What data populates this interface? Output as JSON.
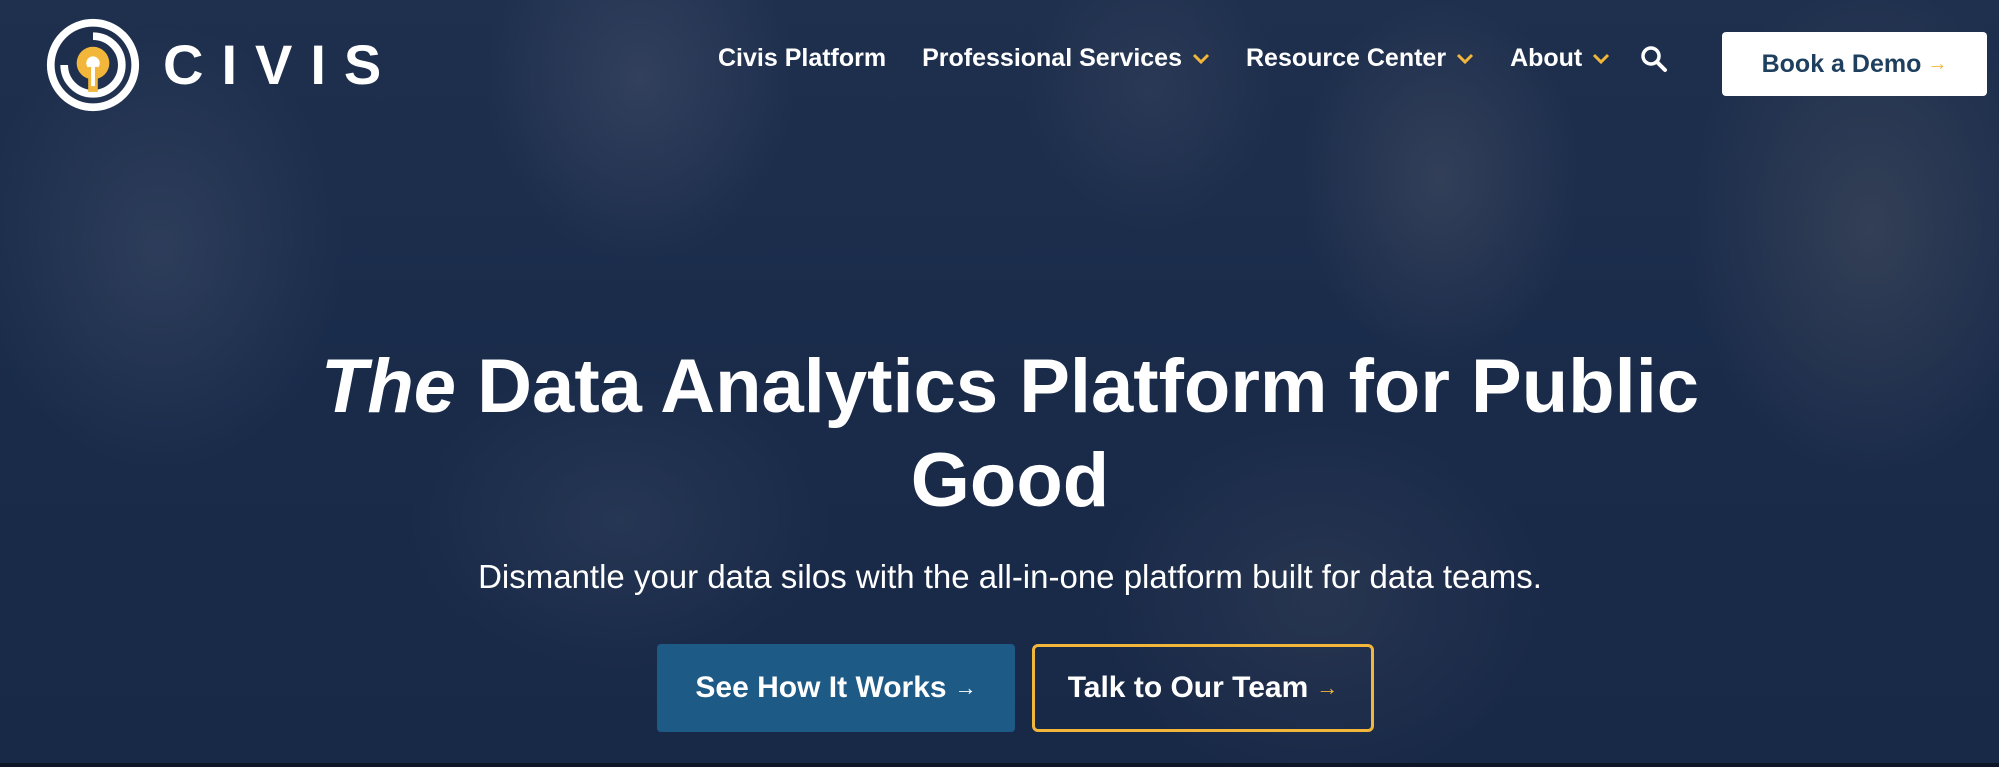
{
  "brand": {
    "name": "CIVIS",
    "accent_color": "#f2b63a",
    "primary_color": "#1e5a86"
  },
  "nav": {
    "items": [
      {
        "label": "Civis Platform",
        "has_dropdown": false
      },
      {
        "label": "Professional Services",
        "has_dropdown": true
      },
      {
        "label": "Resource Center",
        "has_dropdown": true
      },
      {
        "label": "About",
        "has_dropdown": true
      }
    ],
    "search_icon": "search-icon",
    "cta_label": "Book a Demo"
  },
  "hero": {
    "headline_emphasis": "The",
    "headline_rest": "Data Analytics Platform for Public Good",
    "subheadline": "Dismantle your data silos with the all-in-one platform built for data teams.",
    "primary_cta": "See How It Works",
    "secondary_cta": "Talk to Our Team"
  },
  "icons": {
    "arrow": "→"
  }
}
